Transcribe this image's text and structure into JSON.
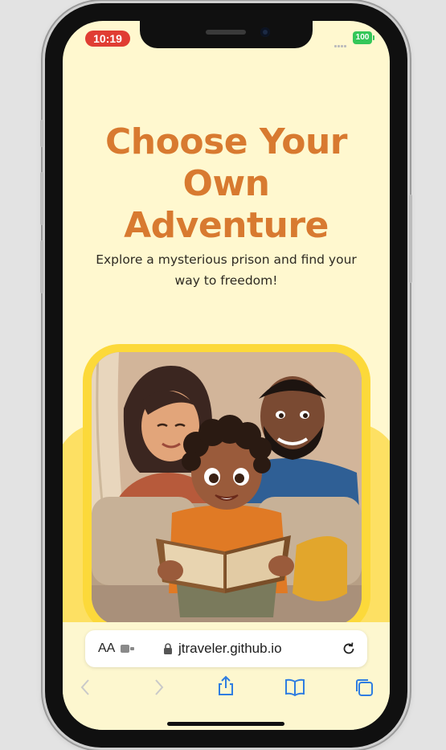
{
  "status_bar": {
    "time": "10:19",
    "battery": "100"
  },
  "hero": {
    "title_line1": "Choose Your",
    "title_line2": "Own",
    "title_line3": "Adventure",
    "subtitle": "Explore a mysterious prison and find your way to freedom!"
  },
  "colors": {
    "title": "#d87a30",
    "background": "#fff8cf",
    "accent_yellow": "#fcd93a",
    "safari_blue": "#2f7de1"
  },
  "safari": {
    "text_size_label": "AA",
    "url": "jtraveler.github.io",
    "icons": [
      "text-size-icon",
      "extension-icon",
      "lock-icon",
      "reload-icon",
      "back-icon",
      "forward-icon",
      "share-icon",
      "bookmarks-icon",
      "tabs-icon"
    ]
  }
}
